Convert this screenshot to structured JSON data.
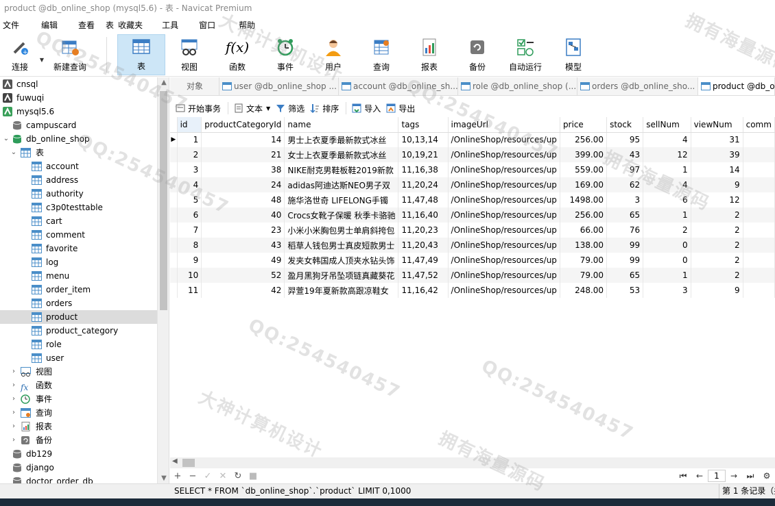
{
  "window": {
    "title": "product @db_online_shop (mysql5.6) - 表 - Navicat Premium"
  },
  "menu": [
    "文件",
    "编辑",
    "查看",
    "表",
    "收藏夹",
    "工具",
    "窗口",
    "帮助"
  ],
  "toolbar": {
    "connect": "连接",
    "new_query": "新建查询",
    "table": "表",
    "view": "视图",
    "function": "函数",
    "event": "事件",
    "user": "用户",
    "query": "查询",
    "report": "报表",
    "backup": "备份",
    "autorun": "自动运行",
    "model": "模型"
  },
  "tree": {
    "connections": [
      "cnsql",
      "fuwuqi",
      "mysql5.6"
    ],
    "databases_before": [
      "campuscard",
      "db_online_shop"
    ],
    "tables_label": "表",
    "tables": [
      "account",
      "address",
      "authority",
      "c3p0testtable",
      "cart",
      "comment",
      "favorite",
      "log",
      "menu",
      "order_item",
      "orders",
      "product",
      "product_category",
      "role",
      "user"
    ],
    "groups": [
      "视图",
      "函数",
      "事件",
      "查询",
      "报表",
      "备份"
    ],
    "databases_after": [
      "db129",
      "django",
      "doctor_order_db"
    ]
  },
  "tabs": [
    "对象",
    "user @db_online_shop ...",
    "account @db_online_sh...",
    "role @db_online_shop (...",
    "orders @db_online_sho...",
    "product @db_o"
  ],
  "subtoolbar": {
    "begin_tx": "开始事务",
    "text": "文本",
    "filter": "筛选",
    "sort": "排序",
    "import": "导入",
    "export": "导出"
  },
  "grid": {
    "columns": [
      "id",
      "productCategoryId",
      "name",
      "tags",
      "imageUrl",
      "price",
      "stock",
      "sellNum",
      "viewNum",
      "comm"
    ],
    "rows": [
      [
        "1",
        "14",
        "男士上衣夏季最新款式冰丝",
        "10,13,14",
        "/OnlineShop/resources/up",
        "256.00",
        "95",
        "4",
        "31"
      ],
      [
        "2",
        "21",
        "女士上衣夏季最新款式冰丝",
        "10,19,21",
        "/OnlineShop/resources/up",
        "399.00",
        "43",
        "12",
        "39"
      ],
      [
        "3",
        "38",
        "NIKE耐克男鞋板鞋2019新款",
        "11,16,38",
        "/OnlineShop/resources/up",
        "559.00",
        "97",
        "1",
        "14"
      ],
      [
        "4",
        "24",
        "adidas阿迪达斯NEO男子双",
        "11,20,24",
        "/OnlineShop/resources/up",
        "169.00",
        "62",
        "4",
        "9"
      ],
      [
        "5",
        "48",
        "施华洛世奇 LIFELONG手镯",
        "11,47,48",
        "/OnlineShop/resources/up",
        "1498.00",
        "3",
        "6",
        "12"
      ],
      [
        "6",
        "40",
        "Crocs女靴子保暖 秋季卡骆驰",
        "11,16,40",
        "/OnlineShop/resources/up",
        "256.00",
        "65",
        "1",
        "2"
      ],
      [
        "7",
        "23",
        "小米小米胸包男士单肩斜挎包",
        "11,20,23",
        "/OnlineShop/resources/up",
        "66.00",
        "76",
        "2",
        "2"
      ],
      [
        "8",
        "43",
        "稻草人钱包男士真皮短款男士",
        "11,20,43",
        "/OnlineShop/resources/up",
        "138.00",
        "99",
        "0",
        "2"
      ],
      [
        "9",
        "49",
        "发夹女韩国成人顶夹水钻头饰",
        "11,47,49",
        "/OnlineShop/resources/up",
        "79.00",
        "99",
        "0",
        "2"
      ],
      [
        "10",
        "52",
        "盈月黑狗牙吊坠项链真藏葵花",
        "11,47,52",
        "/OnlineShop/resources/up",
        "79.00",
        "65",
        "1",
        "2"
      ],
      [
        "11",
        "42",
        "羿萱19年夏新款高跟凉鞋女",
        "11,16,42",
        "/OnlineShop/resources/up",
        "248.00",
        "53",
        "3",
        "9"
      ]
    ]
  },
  "pager": {
    "page": "1"
  },
  "status": {
    "sql": "SELECT * FROM `db_online_shop`.`product` LIMIT 0,1000",
    "records": "第 1 条记录（共"
  },
  "watermarks": [
    "QQ:254540457",
    "大神计算机设计",
    "拥有海量源码"
  ]
}
